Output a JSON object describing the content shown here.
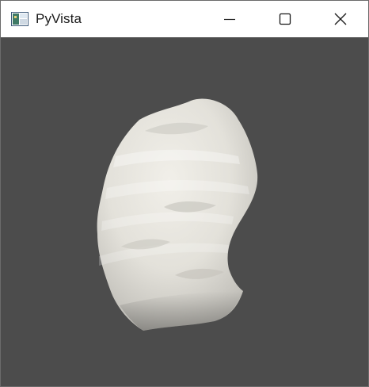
{
  "window": {
    "title": "PyVista",
    "icon": "pyvista-app-icon"
  },
  "controls": {
    "minimize_icon": "minimize-icon",
    "maximize_icon": "maximize-icon",
    "close_icon": "close-icon"
  },
  "viewport": {
    "background_color": "#4c4c4c",
    "mesh_color": "#e4e2db"
  }
}
